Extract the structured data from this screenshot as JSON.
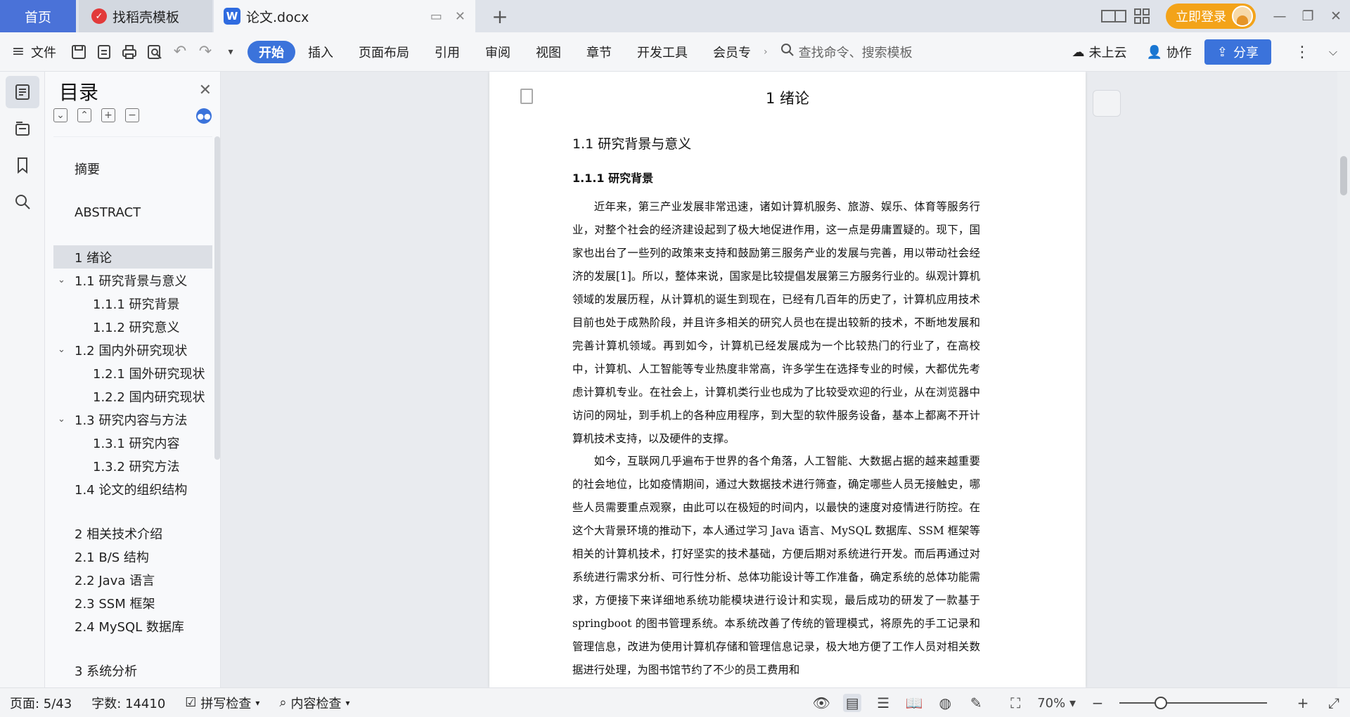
{
  "tabs": {
    "home": "首页",
    "template": "找稻壳模板",
    "document": "论文.docx",
    "login": "立即登录"
  },
  "ribbon": {
    "file": "文件",
    "tabs": [
      "开始",
      "插入",
      "页面布局",
      "引用",
      "审阅",
      "视图",
      "章节",
      "开发工具",
      "会员专"
    ],
    "search_placeholder": "查找命令、搜索模板",
    "cloud": "未上云",
    "collab": "协作",
    "share": "分享"
  },
  "toc": {
    "title": "目录",
    "items": [
      {
        "text": "摘要",
        "level": 1
      },
      {
        "text": "ABSTRACT",
        "level": 1
      },
      {
        "text": "1 绪论",
        "level": 1
      },
      {
        "text": "1.1 研究背景与意义",
        "level": 2
      },
      {
        "text": "1.1.1 研究背景",
        "level": 3
      },
      {
        "text": "1.1.2 研究意义",
        "level": 3
      },
      {
        "text": "1.2 国内外研究现状",
        "level": 2
      },
      {
        "text": "1.2.1 国外研究现状",
        "level": 3
      },
      {
        "text": "1.2.2 国内研究现状",
        "level": 3
      },
      {
        "text": "1.3 研究内容与方法",
        "level": 2
      },
      {
        "text": "1.3.1 研究内容",
        "level": 3
      },
      {
        "text": "1.3.2 研究方法",
        "level": 3
      },
      {
        "text": "1.4 论文的组织结构",
        "level": 1
      },
      {
        "text": "2 相关技术介绍",
        "level": 1
      },
      {
        "text": "2.1 B/S 结构",
        "level": 1
      },
      {
        "text": "2.2 Java 语言",
        "level": 1
      },
      {
        "text": "2.3 SSM 框架",
        "level": 1
      },
      {
        "text": "2.4 MySQL 数据库",
        "level": 1
      },
      {
        "text": "3 系统分析",
        "level": 1
      }
    ]
  },
  "document": {
    "chapter_title": "1 绪论",
    "section_title": "1.1 研究背景与意义",
    "subsection_title": "1.1.1 研究背景",
    "paragraphs": [
      "近年来，第三产业发展非常迅速，诸如计算机服务、旅游、娱乐、体育等服务行业，对整个社会的经济建设起到了极大地促进作用，这一点是毋庸置疑的。现下，国家也出台了一些列的政策来支持和鼓励第三服务产业的发展与完善，用以带动社会经济的发展[1]。所以，整体来说，国家是比较提倡发展第三方服务行业的。纵观计算机领域的发展历程，从计算机的诞生到现在，已经有几百年的历史了，计算机应用技术目前也处于成熟阶段，并且许多相关的研究人员也在提出较新的技术，不断地发展和完善计算机领域。再到如今，计算机已经发展成为一个比较热门的行业了，在高校中，计算机、人工智能等专业热度非常高，许多学生在选择专业的时候，大都优先考虑计算机专业。在社会上，计算机类行业也成为了比较受欢迎的行业，从在浏览器中访问的网址，到手机上的各种应用程序，到大型的软件服务设备，基本上都离不开计算机技术支持，以及硬件的支撑。",
      "如今，互联网几乎遍布于世界的各个角落，人工智能、大数据占据的越来越重要的社会地位，比如疫情期间，通过大数据技术进行筛查，确定哪些人员无接触史，哪些人员需要重点观察，由此可以在极短的时间内，以最快的速度对疫情进行防控。在这个大背景环境的推动下，本人通过学习 Java 语言、MySQL 数据库、SSM 框架等相关的计算机技术，打好坚实的技术基础，方便后期对系统进行开发。而后再通过对系统进行需求分析、可行性分析、总体功能设计等工作准备，确定系统的总体功能需求，方便接下来详细地系统功能模块进行设计和实现，最后成功的研发了一款基于 springboot 的图书管理系统。本系统改善了传统的管理模式，将原先的手工记录和管理信息，改进为使用计算机存储和管理信息记录，极大地方便了工作人员对相关数据进行处理，为图书馆节约了不少的员工费用和"
    ]
  },
  "status": {
    "page": "页面: 5/43",
    "words": "字数: 14410",
    "spell": "拼写检查",
    "content": "内容检查",
    "zoom": "70%",
    "zoom_level": 0.28
  },
  "colors": {
    "accent": "#3b73db",
    "login": "#f3a319"
  }
}
